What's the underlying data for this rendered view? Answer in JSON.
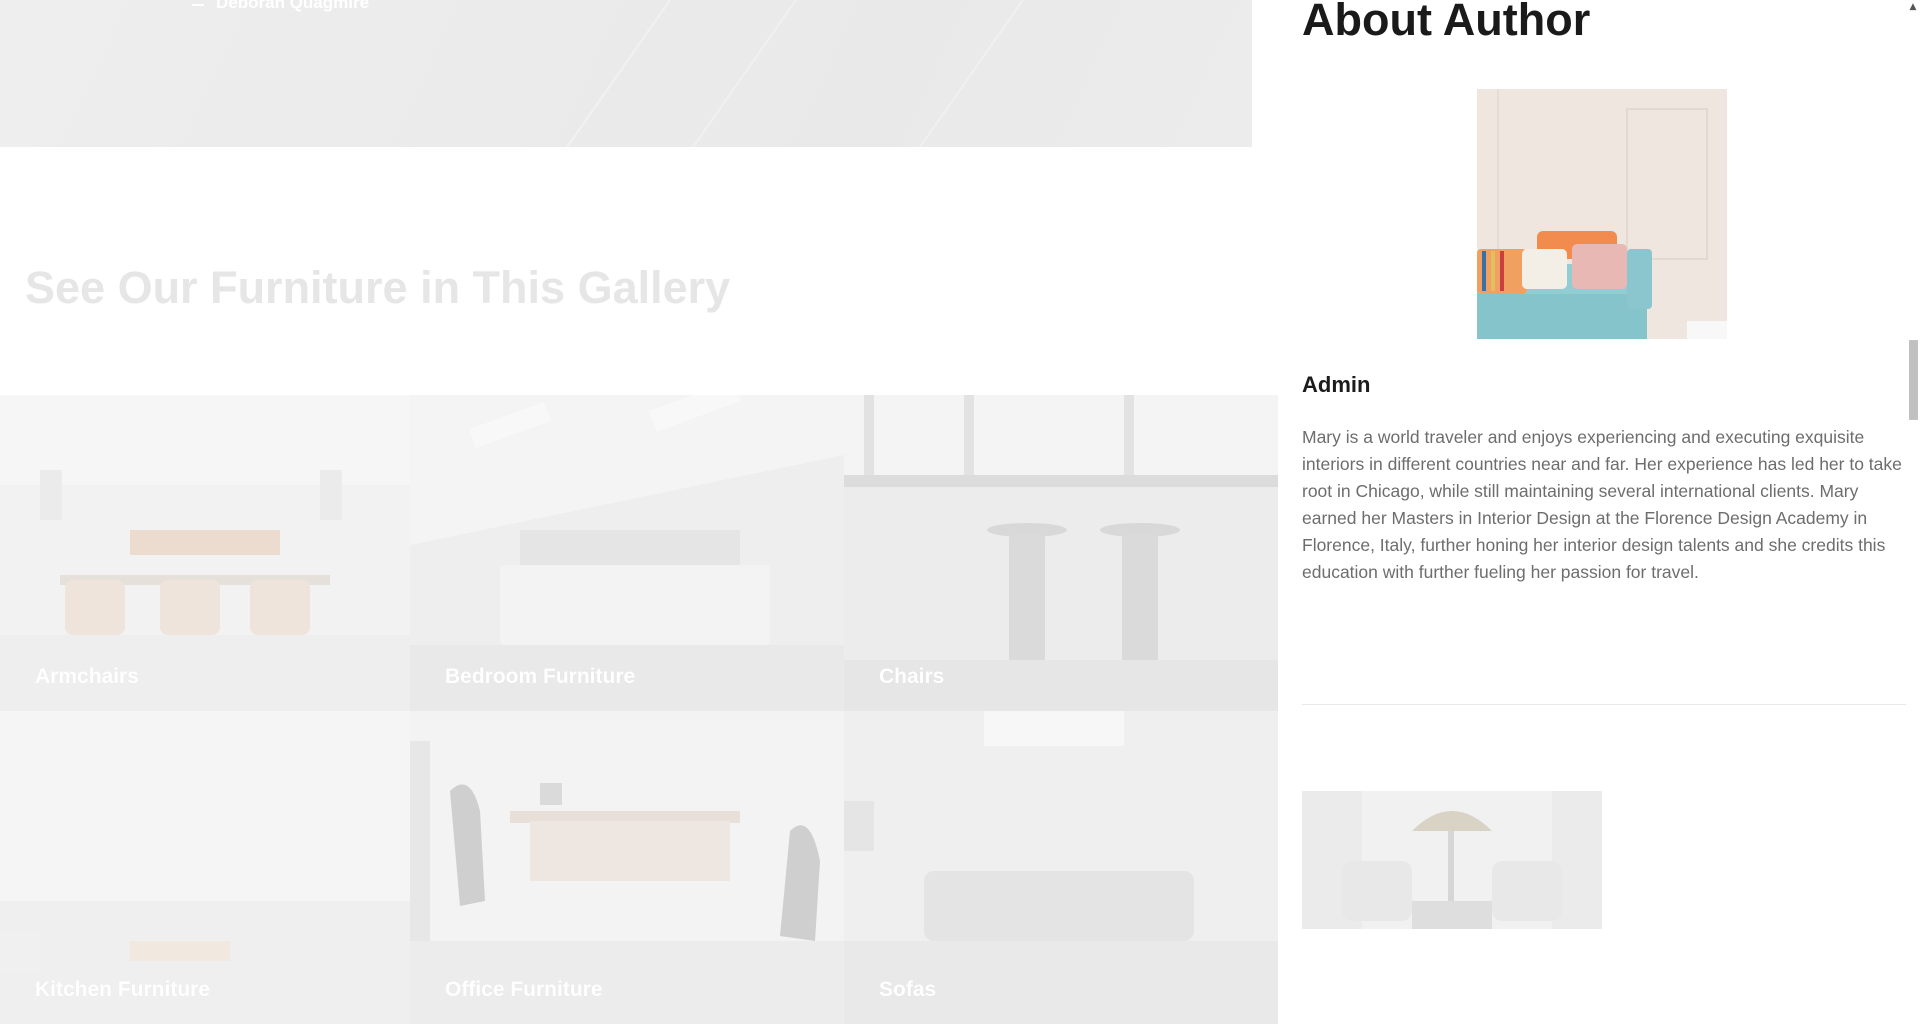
{
  "testimonial": {
    "author": "Deborah Quagmire"
  },
  "gallery": {
    "heading": "See Our Furniture in This Gallery",
    "tiles": [
      {
        "label": "Armchairs"
      },
      {
        "label": "Bedroom Furniture"
      },
      {
        "label": "Chairs"
      },
      {
        "label": "Kitchen Furniture"
      },
      {
        "label": "Office Furniture"
      },
      {
        "label": "Sofas"
      }
    ]
  },
  "sidebar": {
    "about_title": "About Author",
    "author_name": "Admin",
    "author_bio": "Mary is a world traveler and enjoys experiencing and executing exquisite interiors in different countries near and far. Her experience has led her to take root in Chicago, while still maintaining several international clients. Mary earned her Masters in Interior Design at the Florence Design Academy in Florence, Italy, further honing her interior design talents and she credits this education with further fueling her passion for travel."
  },
  "icons": {
    "scroll_up": "triangle-up-icon"
  },
  "colors": {
    "overlay_white": "#ffffff",
    "heading_dark": "#1a1a1a",
    "body_text": "#6d6d6d",
    "faded_heading": "#e6e6e6"
  }
}
